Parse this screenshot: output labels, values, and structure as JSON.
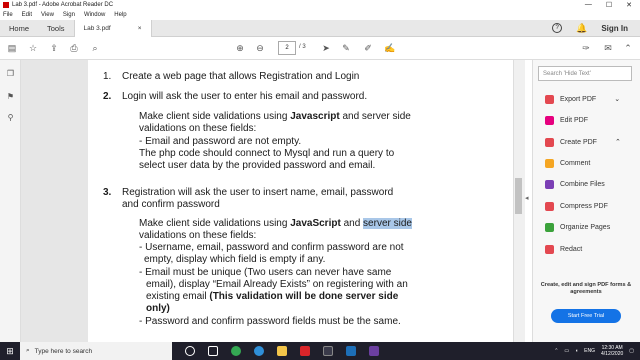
{
  "window": {
    "title": "Lab 3.pdf - Adobe Acrobat Reader DC"
  },
  "menu": [
    "File",
    "Edit",
    "View",
    "Sign",
    "Window",
    "Help"
  ],
  "tabs": {
    "home": "Home",
    "tools": "Tools",
    "document": "Lab 3.pdf",
    "close": "×",
    "help": "?",
    "signin": "Sign In"
  },
  "nav": {
    "current_page": "2",
    "total_pages": "/ 3"
  },
  "document": {
    "item1_num": "1.",
    "item1": "Create a web page that allows Registration and Login",
    "item2_num": "2.",
    "item2": "Login will ask the user to enter his email and password.",
    "p2_a1": "Make client side validations using ",
    "p2_a_bold": "Javascript",
    "p2_a2": " and server side",
    "p2_b": "validations on these fields:",
    "p2_c": "- Email and password are not empty.",
    "p2_d": "The php code should connect to Mysql and run a query to",
    "p2_e": "select user data by the provided password and email.",
    "item3_num": "3.",
    "item3_a": "Registration will ask the user to insert name, email, password",
    "item3_b": "and confirm password",
    "p3_a1": "Make client side validations using ",
    "p3_a_bold": "JavaScript",
    "p3_a2": " and ",
    "p3_a_sel": "server side",
    "p3_b": "validations on these fields:",
    "p3_c": "- Username, email, password and confirm password are not",
    "p3_d": "empty, display which field is empty if any.",
    "p3_e": "- Email must be unique (Two users can never have same",
    "p3_f": "email), display “Email Already Exists” on registering with an",
    "p3_g1": "existing email ",
    "p3_g_bold": "(This validation will be done server side",
    "p3_h_bold": "only)",
    "p3_i": "- Password and confirm password fields must be the same."
  },
  "right_panel": {
    "search_placeholder": "Search 'Hide Text'",
    "tools": [
      {
        "label": "Export PDF",
        "color": "#e34850"
      },
      {
        "label": "Edit PDF",
        "color": "#e6007e"
      },
      {
        "label": "Create PDF",
        "color": "#e34850"
      },
      {
        "label": "Comment",
        "color": "#f5a623"
      },
      {
        "label": "Combine Files",
        "color": "#7b3fb5"
      },
      {
        "label": "Compress PDF",
        "color": "#e34850"
      },
      {
        "label": "Organize Pages",
        "color": "#3ba23b"
      },
      {
        "label": "Redact",
        "color": "#e34850"
      }
    ],
    "promo": "Create, edit and sign PDF forms & agreements",
    "trial_button": "Start Free Trial"
  },
  "taskbar": {
    "search_placeholder": "Type here to search",
    "time": "12:30 AM",
    "date": "4/12/2020",
    "lang": "ENG"
  }
}
